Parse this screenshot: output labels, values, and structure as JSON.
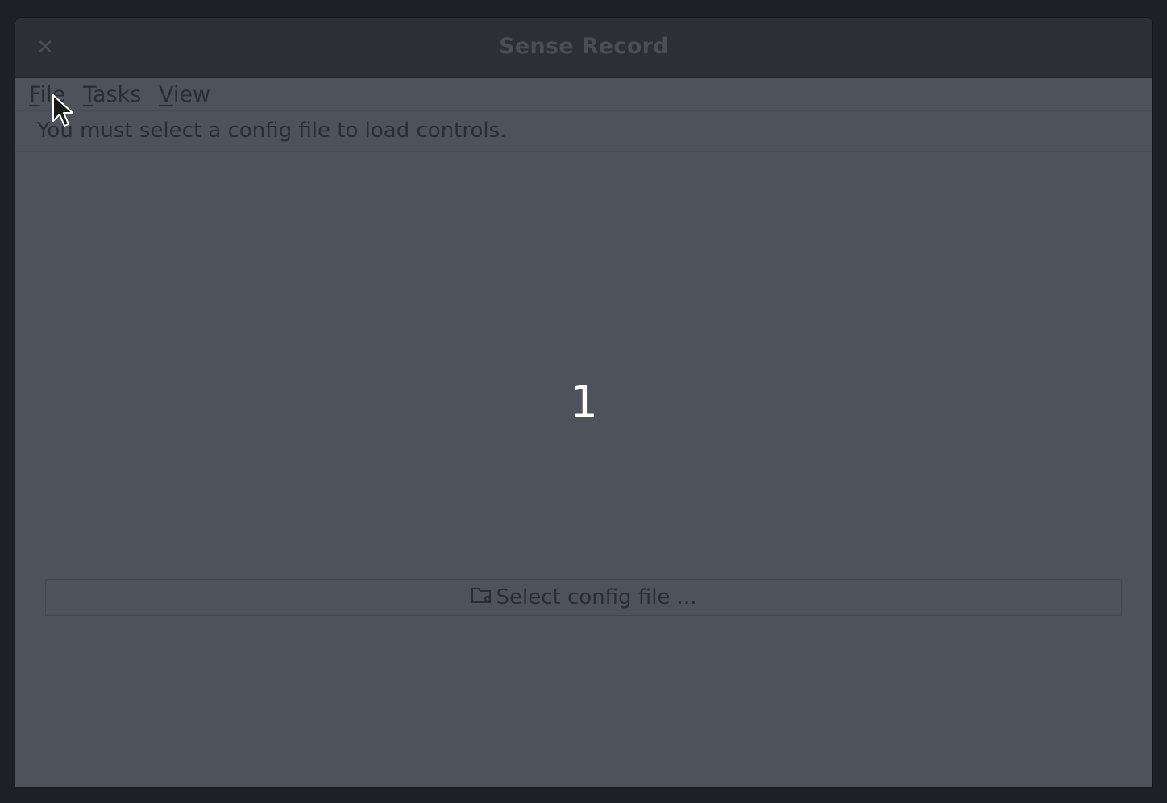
{
  "window": {
    "title": "Sense Record",
    "close_icon": "close-icon"
  },
  "menubar": {
    "items": [
      {
        "label_mnemonic": "F",
        "label_rest": "ile"
      },
      {
        "label_mnemonic": "T",
        "label_rest": "asks"
      },
      {
        "label_mnemonic": "V",
        "label_rest": "iew"
      }
    ]
  },
  "info": {
    "message": "You must select a config file to load controls."
  },
  "countdown": {
    "value": "1"
  },
  "select_button": {
    "label": "Select config file ...",
    "icon": "folder-settings-icon"
  },
  "colors": {
    "window_bg": "#4e525b",
    "titlebar_bg": "#2c2f36",
    "text_dark": "#2a2d33",
    "countdown_text": "#ffffff"
  }
}
